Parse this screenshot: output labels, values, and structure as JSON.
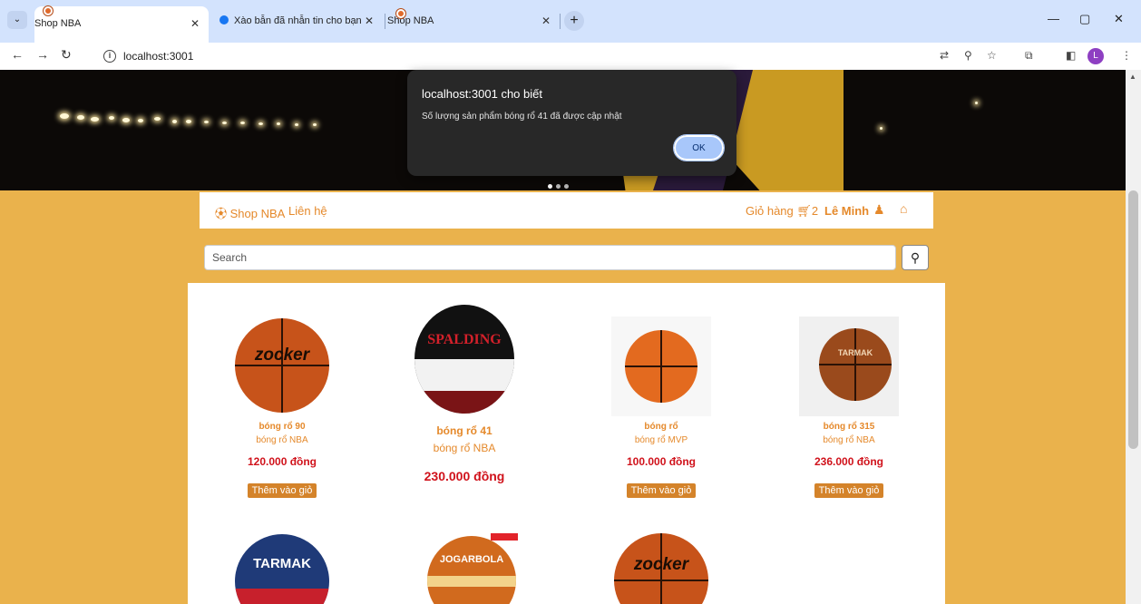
{
  "browser": {
    "tabs": [
      {
        "title": "Shop NBA",
        "active": true
      },
      {
        "title": "Xào bẫn đã nhẫn tin cho bạn",
        "active": false
      },
      {
        "title": "Shop NBA",
        "active": false
      }
    ],
    "url": "localhost:3001"
  },
  "navbar": {
    "brand": "Shop NBA",
    "contact": "Liên hệ",
    "cart_label": "Giỏ hàng",
    "cart_count": "2",
    "user_name": "Lê Minh"
  },
  "search": {
    "placeholder": "Search"
  },
  "products": [
    {
      "name": "bóng rổ 90",
      "category": "bóng rổ NBA",
      "price": "120.000 đồng",
      "button": "Thêm vào giỏ",
      "image_text": "zocker"
    },
    {
      "name": "bóng rổ 41",
      "category": "bóng rổ NBA",
      "price": "230.000 đồng",
      "button": "",
      "image_text": "SPALDING"
    },
    {
      "name": "bóng rổ",
      "category": "bóng rổ MVP",
      "price": "100.000 đồng",
      "button": "Thêm vào giỏ",
      "image_text": ""
    },
    {
      "name": "bóng rổ 315",
      "category": "bóng rổ NBA",
      "price": "236.000 đồng",
      "button": "Thêm vào giỏ",
      "image_text": "TARMAK"
    },
    {
      "image_text": "TARMAK"
    },
    {
      "image_text": "JOGARBOLA"
    },
    {
      "image_text": "zocker"
    }
  ],
  "dialog": {
    "title": "localhost:3001 cho biết",
    "message": "Số lượng sản phẩm bóng rổ 41 đã được cập nhật",
    "ok_label": "OK"
  },
  "colors": {
    "page_background": "#eab24c",
    "accent": "#e5892b",
    "price": "#d0121b",
    "button": "#d4832a"
  }
}
